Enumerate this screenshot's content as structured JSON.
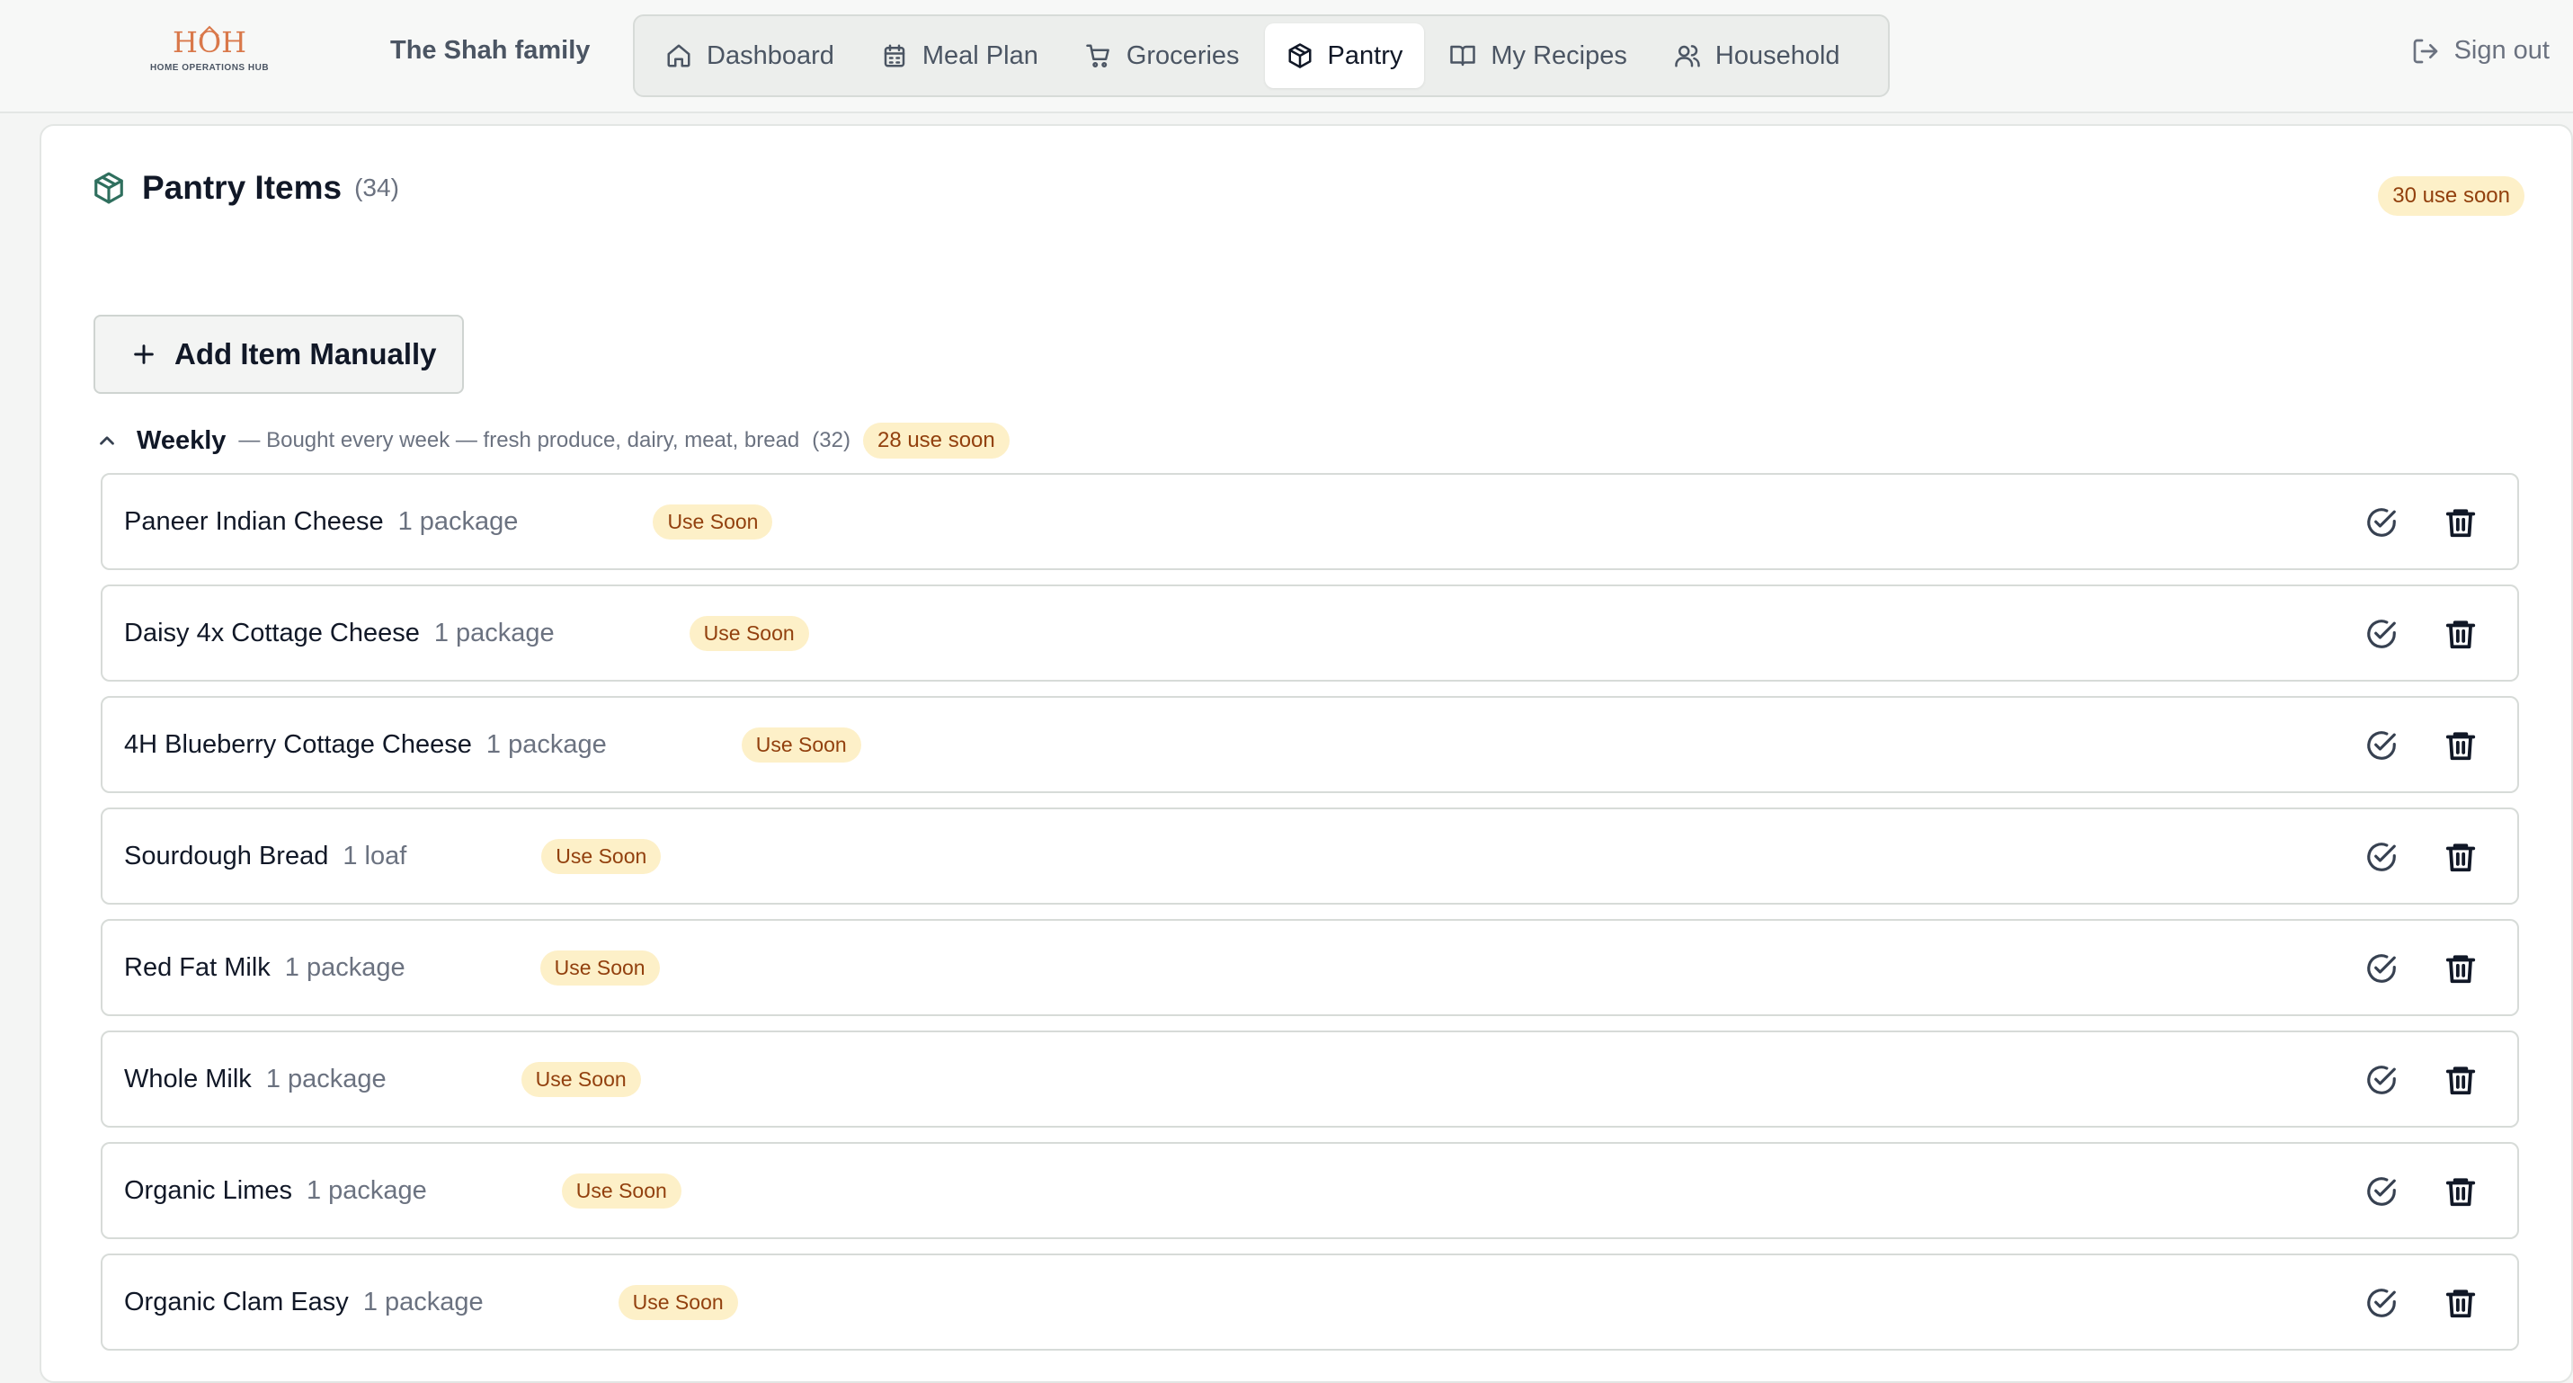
{
  "brand": {
    "logo_text": "HOH",
    "logo_sub": "HOME OPERATIONS HUB",
    "family": "The Shah family"
  },
  "nav": {
    "tabs": [
      {
        "label": "Dashboard",
        "icon": "home-icon",
        "active": false
      },
      {
        "label": "Meal Plan",
        "icon": "calendar-icon",
        "active": false
      },
      {
        "label": "Groceries",
        "icon": "cart-icon",
        "active": false
      },
      {
        "label": "Pantry",
        "icon": "box-icon",
        "active": true
      },
      {
        "label": "My Recipes",
        "icon": "book-icon",
        "active": false
      },
      {
        "label": "Household",
        "icon": "users-icon",
        "active": false
      }
    ],
    "signout": "Sign out"
  },
  "pantry": {
    "title": "Pantry Items",
    "count": "(34)",
    "summary_badge": "30 use soon",
    "add_button": "Add Item Manually",
    "group": {
      "name": "Weekly",
      "description": "— Bought every week — fresh produce, dairy, meat, bread",
      "count": "(32)",
      "badge": "28 use soon"
    },
    "items": [
      {
        "name": "Paneer Indian Cheese",
        "qty": "1 package",
        "badge": "Use Soon"
      },
      {
        "name": "Daisy 4x Cottage Cheese",
        "qty": "1 package",
        "badge": "Use Soon"
      },
      {
        "name": "4H Blueberry Cottage Cheese",
        "qty": "1 package",
        "badge": "Use Soon"
      },
      {
        "name": "Sourdough Bread",
        "qty": "1 loaf",
        "badge": "Use Soon"
      },
      {
        "name": "Red Fat Milk",
        "qty": "1 package",
        "badge": "Use Soon"
      },
      {
        "name": "Whole Milk",
        "qty": "1 package",
        "badge": "Use Soon"
      },
      {
        "name": "Organic Limes",
        "qty": "1 package",
        "badge": "Use Soon"
      },
      {
        "name": "Organic Clam Easy",
        "qty": "1 package",
        "badge": "Use Soon"
      }
    ]
  },
  "colors": {
    "accent": "#2f6f5e",
    "badge_bg": "#fdf0c8",
    "badge_text": "#92400e",
    "logo": "#d9784a"
  }
}
